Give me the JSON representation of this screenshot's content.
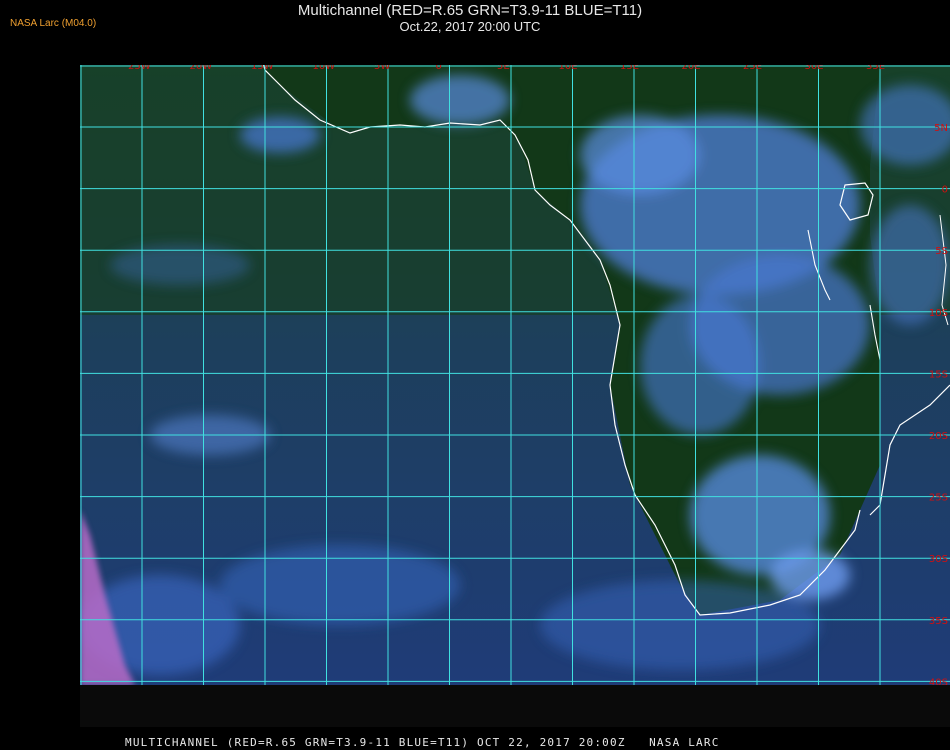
{
  "header": {
    "title_line1": "Multichannel (RED=R.65 GRN=T3.9-11 BLUE=T11)",
    "title_line2": "Oct.22, 2017 20:00 UTC",
    "provider": "NASA Larc (M04.0)"
  },
  "footer": {
    "caption": "MULTICHANNEL (RED=R.65 GRN=T3.9-11 BLUE=T11) OCT 22, 2017 20:00Z   NASA LARC"
  },
  "map": {
    "lon_labels": [
      "25W",
      "20W",
      "15W",
      "10W",
      "5W",
      "0",
      "5E",
      "10E",
      "15E",
      "20E",
      "25E",
      "30E",
      "35E"
    ],
    "lat_labels": [
      "5N",
      "0",
      "5S",
      "10S",
      "15S",
      "20S",
      "25S",
      "30S",
      "35S",
      "40S"
    ],
    "colors": {
      "grid": "#40e0e0",
      "coast": "#ffffff",
      "label": "#d01010",
      "ocean": "#1d3f66",
      "land": "#123a1a",
      "cloud": "#5a8ee0"
    }
  }
}
